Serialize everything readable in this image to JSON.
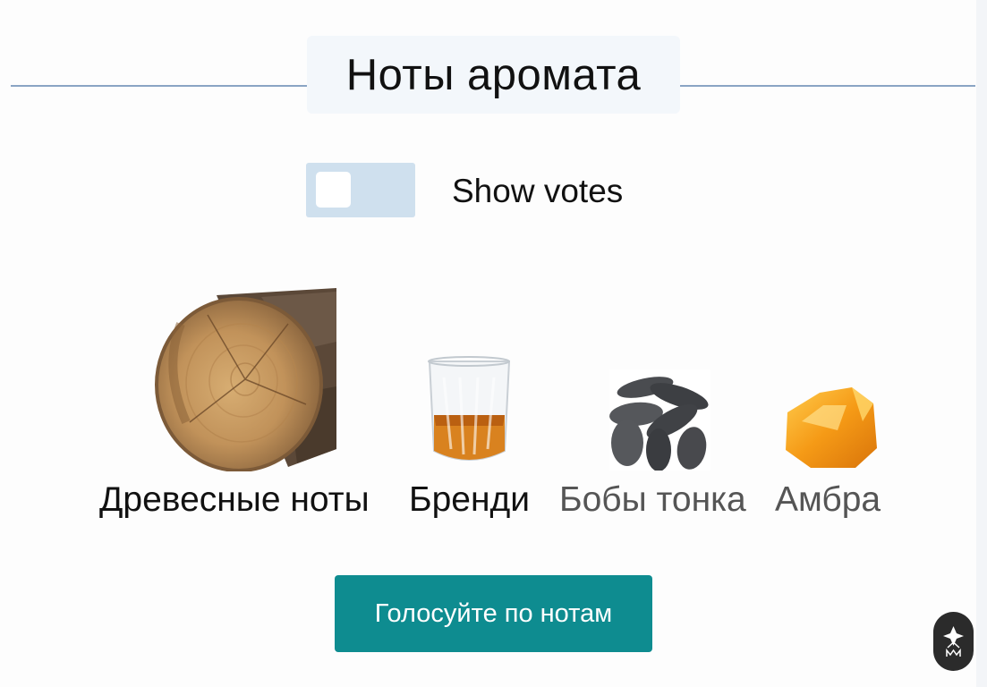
{
  "header": {
    "title": "Ноты аромата"
  },
  "votes_toggle": {
    "label": "Show votes",
    "checked": false
  },
  "notes": [
    {
      "label": "Древесные ноты",
      "icon": "wood-log-image"
    },
    {
      "label": "Бренди",
      "icon": "brandy-glass-image"
    },
    {
      "label": "Бобы тонка",
      "icon": "tonka-beans-image"
    },
    {
      "label": "Амбра",
      "icon": "amber-image"
    }
  ],
  "actions": {
    "vote_label": "Голосуйте по нотам"
  },
  "colors": {
    "accent": "#0e8c90",
    "rule": "#8aa4c4",
    "toggle_bg": "#cfe0ee"
  },
  "badge": {
    "icon": "brand-logo-icon"
  }
}
